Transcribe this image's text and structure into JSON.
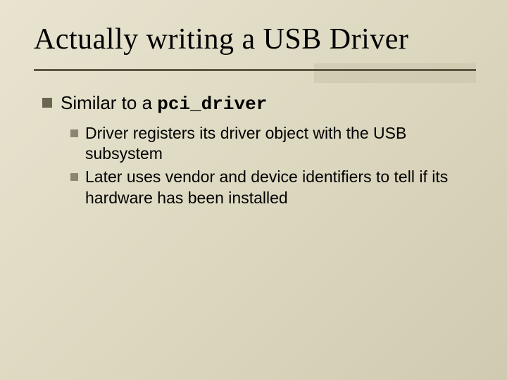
{
  "title": "Actually writing a USB Driver",
  "bullet1_prefix": "Similar to a ",
  "bullet1_code": "pci_driver",
  "sub_bullets": [
    "Driver registers its driver object with the USB subsystem",
    "Later uses vendor and device identifiers to tell if its hardware has been installed"
  ]
}
